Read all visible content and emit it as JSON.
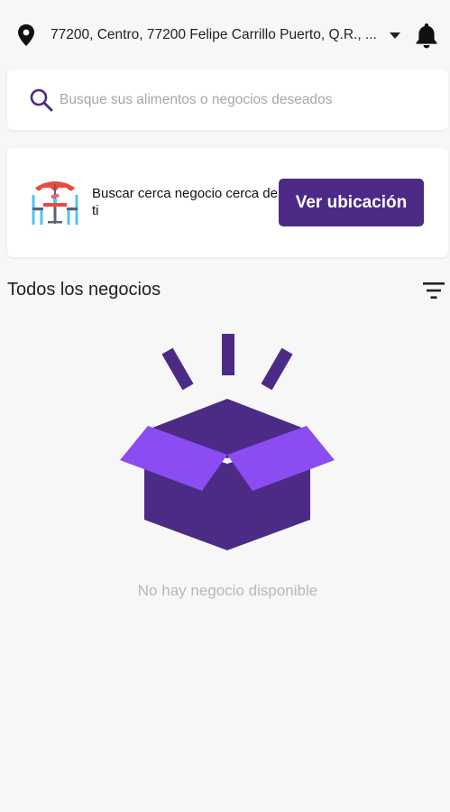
{
  "header": {
    "address": "77200, Centro, 77200 Felipe Carrillo Puerto, Q.R., ...",
    "location_icon": "map-pin-icon",
    "dropdown_icon": "caret-down-icon",
    "notifications_icon": "bell-icon"
  },
  "search": {
    "placeholder": "Busque sus alimentos o negocios deseados",
    "value": "",
    "icon": "search-icon"
  },
  "promo": {
    "text": "Buscar cerca negocio cerca de ti",
    "button_label": "Ver ubicación",
    "icon": "cafe-table-icon"
  },
  "business_list": {
    "title": "Todos los negocios",
    "filter_icon": "filter-icon",
    "empty_message": "No hay negocio disponible",
    "empty_icon": "open-box-icon"
  },
  "colors": {
    "primary": "#4c2b86",
    "accent_light": "#8b4cf2",
    "background": "#f7f7f7",
    "card": "#ffffff",
    "muted_text": "#b8b8b8"
  }
}
